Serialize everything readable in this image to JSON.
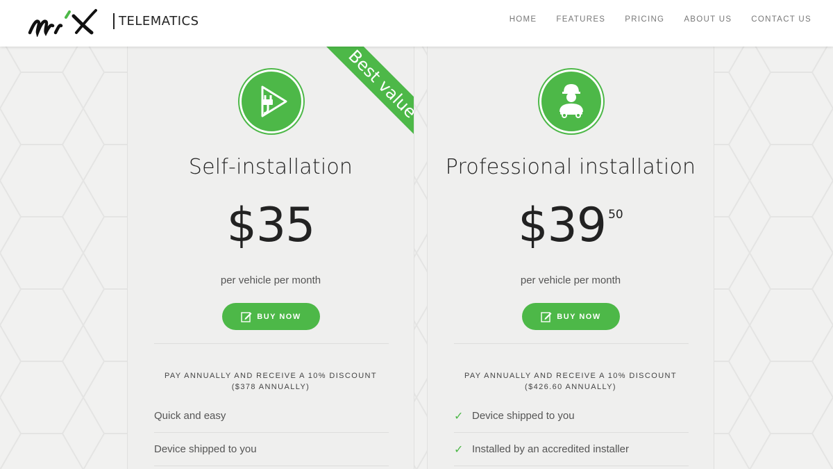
{
  "header": {
    "logo_text": "TELEMATICS",
    "nav": [
      "HOME",
      "FEATURES",
      "PRICING",
      "ABOUT US",
      "CONTACT US"
    ]
  },
  "plans": [
    {
      "icon": "play-plug-icon",
      "ribbon": "Best value",
      "title": "Self-installation",
      "price": "$35",
      "price_cents": "",
      "per": "per vehicle per month",
      "button": "BUY NOW",
      "discount_line1": "PAY ANNUALLY AND RECEIVE A 10% DISCOUNT",
      "discount_line2": "($378 ANNUALLY)",
      "features": [
        "Quick and easy",
        "Device shipped to you"
      ],
      "features_checked": false
    },
    {
      "icon": "installer-icon",
      "title": "Professional installation",
      "price": "$39",
      "price_cents": "50",
      "per": "per vehicle per month",
      "button": "BUY NOW",
      "discount_line1": "PAY ANNUALLY AND RECEIVE A 10% DISCOUNT",
      "discount_line2": "($426.60 ANNUALLY)",
      "features": [
        "Device shipped to you",
        "Installed by an accredited installer"
      ],
      "features_checked": true
    }
  ],
  "colors": {
    "accent": "#4db848",
    "background": "#f1f1f0",
    "text": "#222222"
  }
}
